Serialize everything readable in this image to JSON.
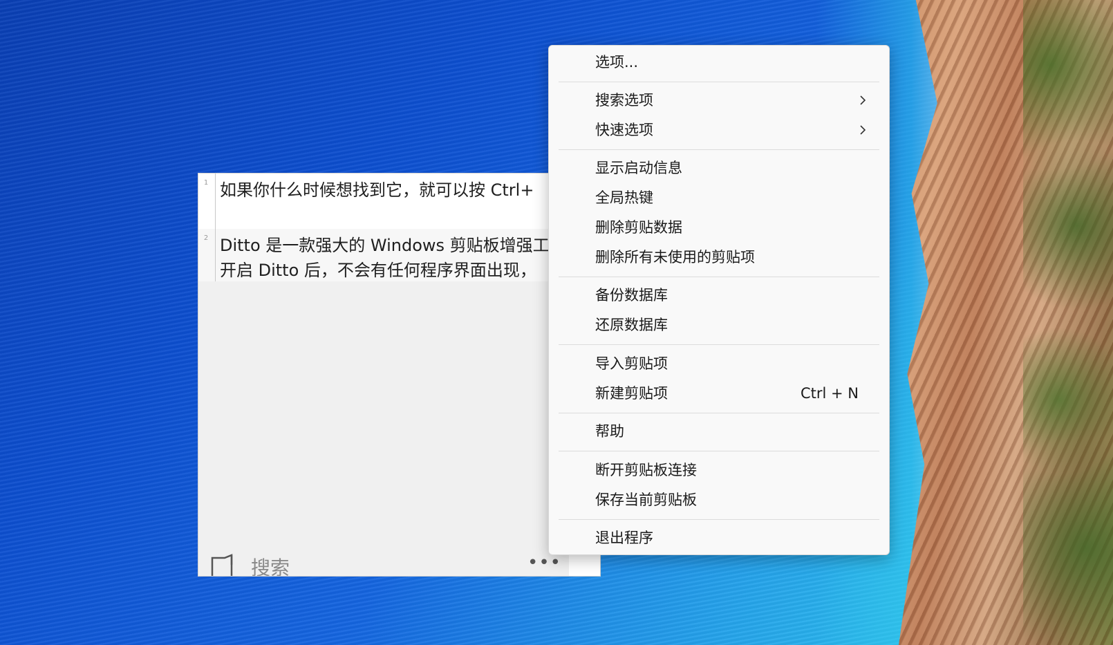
{
  "clipboard_items": [
    {
      "index": "1",
      "lines": [
        "如果你什么时候想找到它，就可以按 Ctrl+"
      ]
    },
    {
      "index": "2",
      "lines": [
        "Ditto 是一款强大的 Windows 剪贴板增强工",
        "开启 Ditto 后，不会有任何程序界面出现，"
      ]
    }
  ],
  "footer": {
    "search_placeholder": "搜索",
    "more_label": "•••",
    "clipboard_icon": "clipboard-icon"
  },
  "menu": {
    "items": [
      {
        "label": "选项..."
      },
      {
        "label": "搜索选项",
        "has_submenu": true
      },
      {
        "label": "快速选项",
        "has_submenu": true
      },
      {
        "label": "显示启动信息"
      },
      {
        "label": "全局热键"
      },
      {
        "label": "删除剪贴数据"
      },
      {
        "label": "删除所有未使用的剪贴项"
      },
      {
        "label": "备份数据库"
      },
      {
        "label": "还原数据库"
      },
      {
        "label": "导入剪贴项"
      },
      {
        "label": "新建剪贴项",
        "shortcut": "Ctrl + N"
      },
      {
        "label": "帮助"
      },
      {
        "label": "断开剪贴板连接"
      },
      {
        "label": "保存当前剪贴板"
      },
      {
        "label": "退出程序"
      }
    ]
  },
  "colors": {
    "menu_background": "#f9f9f9",
    "window_background": "#f0f0f0",
    "text": "#1a1a1a"
  }
}
